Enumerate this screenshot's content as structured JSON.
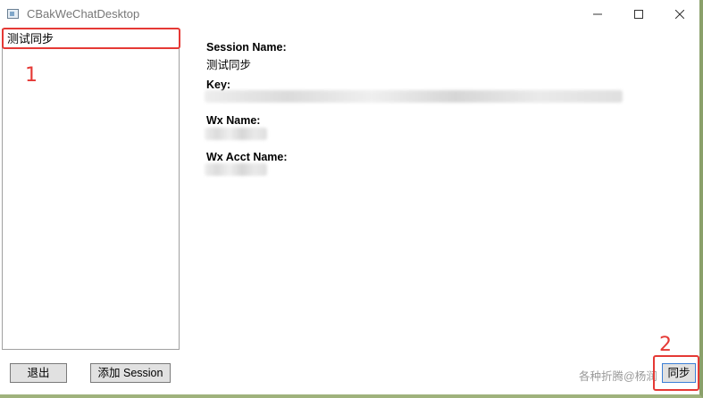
{
  "window": {
    "title": "CBakWeChatDesktop"
  },
  "sessions": {
    "items": [
      "测试同步"
    ]
  },
  "detail": {
    "session_name_label": "Session Name:",
    "session_name_value": "测试同步",
    "key_label": "Key:",
    "wx_name_label": "Wx Name:",
    "wx_acct_name_label": "Wx Acct Name:"
  },
  "buttons": {
    "exit": "退出",
    "add_session": "添加 Session",
    "sync": "同步"
  },
  "annotations": {
    "step1": "1",
    "step2": "2",
    "color": "#e53935"
  },
  "watermark": "各种折腾@杨润",
  "icons": {
    "minimize": "minimize-icon",
    "maximize": "maximize-icon",
    "close": "close-icon",
    "app": "app-icon"
  }
}
